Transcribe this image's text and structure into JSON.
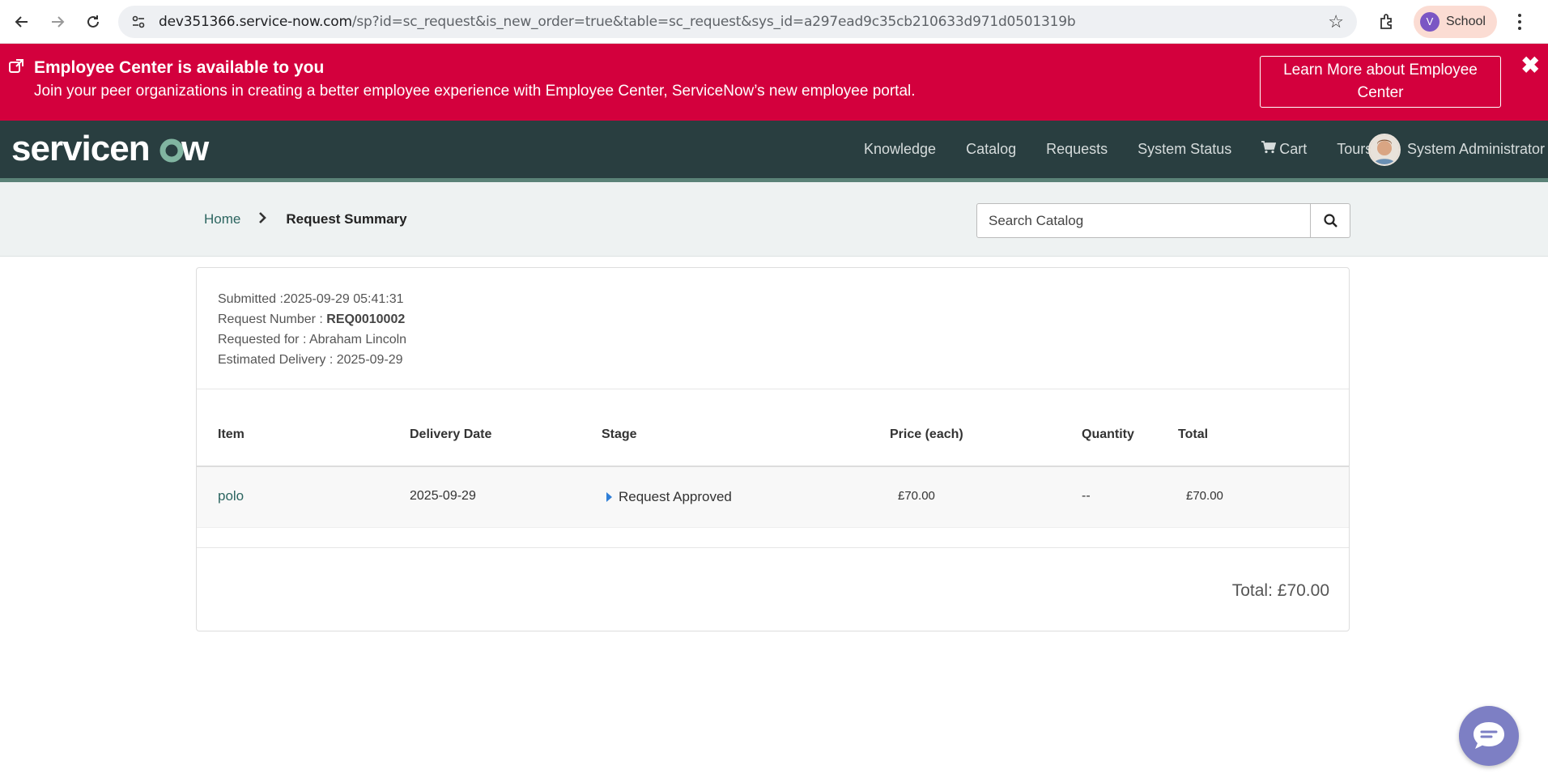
{
  "browser": {
    "url_host": "dev351366.service-now.com",
    "url_rest": "/sp?id=sc_request&is_new_order=true&table=sc_request&sys_id=a297ead9c35cb210633d971d0501319b",
    "profile_initial": "V",
    "profile_label": "School",
    "icons": [
      "back-icon",
      "forward-icon",
      "reload-icon",
      "site-settings-icon",
      "star-icon",
      "extensions-icon",
      "menu-icon"
    ]
  },
  "banner": {
    "title": "Employee Center is available to you",
    "description": "Join your peer organizations in creating a better employee experience with Employee Center, ServiceNow’s new employee portal.",
    "button_label": "Learn More about Employee Center",
    "close_symbol": "✖",
    "color": "#d3003d"
  },
  "header": {
    "logo_text": "servicenow",
    "nav": [
      "Knowledge",
      "Catalog",
      "Requests",
      "System Status",
      "Cart",
      "Tours"
    ],
    "user_name": "System Administrator",
    "color": "#293e40"
  },
  "breadcrumb": {
    "home": "Home",
    "separator": "›",
    "current": "Request Summary"
  },
  "search": {
    "placeholder": "Search Catalog"
  },
  "summary": {
    "submitted_label": "Submitted :",
    "submitted_value": "2025-09-29 05:41:31",
    "request_number_label": "Request Number : ",
    "request_number_value": "REQ0010002",
    "requested_for_label": "Requested for : ",
    "requested_for_value": "Abraham Lincoln",
    "estimated_delivery_label": "Estimated Delivery : ",
    "estimated_delivery_value": "2025-09-29"
  },
  "table": {
    "headers": {
      "item": "Item",
      "delivery_date": "Delivery Date",
      "stage": "Stage",
      "price": "Price (each)",
      "quantity": "Quantity",
      "total": "Total"
    },
    "rows": [
      {
        "item": "polo",
        "delivery_date": "2025-09-29",
        "stage": "Request Approved",
        "price": "£70.00",
        "quantity": "--",
        "total": "£70.00"
      }
    ]
  },
  "grand_total": "Total: £70.00"
}
